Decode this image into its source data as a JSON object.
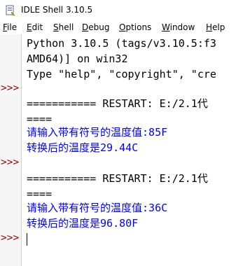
{
  "window": {
    "title": "IDLE Shell 3.10.5"
  },
  "menu": {
    "items": [
      {
        "label": "File",
        "ul": "F",
        "rest": "ile"
      },
      {
        "label": "Edit",
        "ul": "E",
        "rest": "dit"
      },
      {
        "label": "Shell",
        "ul": "S",
        "rest": "hell"
      },
      {
        "label": "Debug",
        "ul": "D",
        "rest": "ebug"
      },
      {
        "label": "Options",
        "ul": "O",
        "rest": "ptions"
      },
      {
        "label": "Window",
        "ul": "W",
        "rest": "indow"
      },
      {
        "label": "Help",
        "ul": "H",
        "rest": "elp"
      }
    ]
  },
  "shell": {
    "prompt": ">>>",
    "lines": [
      "Python 3.10.5 (tags/v3.10.5:f3",
      "AMD64)] on win32",
      "Type \"help\", \"copyright\", \"cre",
      "=========== RESTART: E:/2.1代",
      "====",
      "请输入带有符号的温度值:85F",
      "转换后的温度是",
      "29.44C",
      "=========== RESTART: E:/2.1代",
      "====",
      "请输入带有符号的温度值:36C",
      "转换后的温度是",
      "96.80F"
    ]
  },
  "colors": {
    "prompt": "#8b0000",
    "output": "#0000ff",
    "text": "#000000"
  },
  "icons": {
    "app": "idle-icon"
  }
}
